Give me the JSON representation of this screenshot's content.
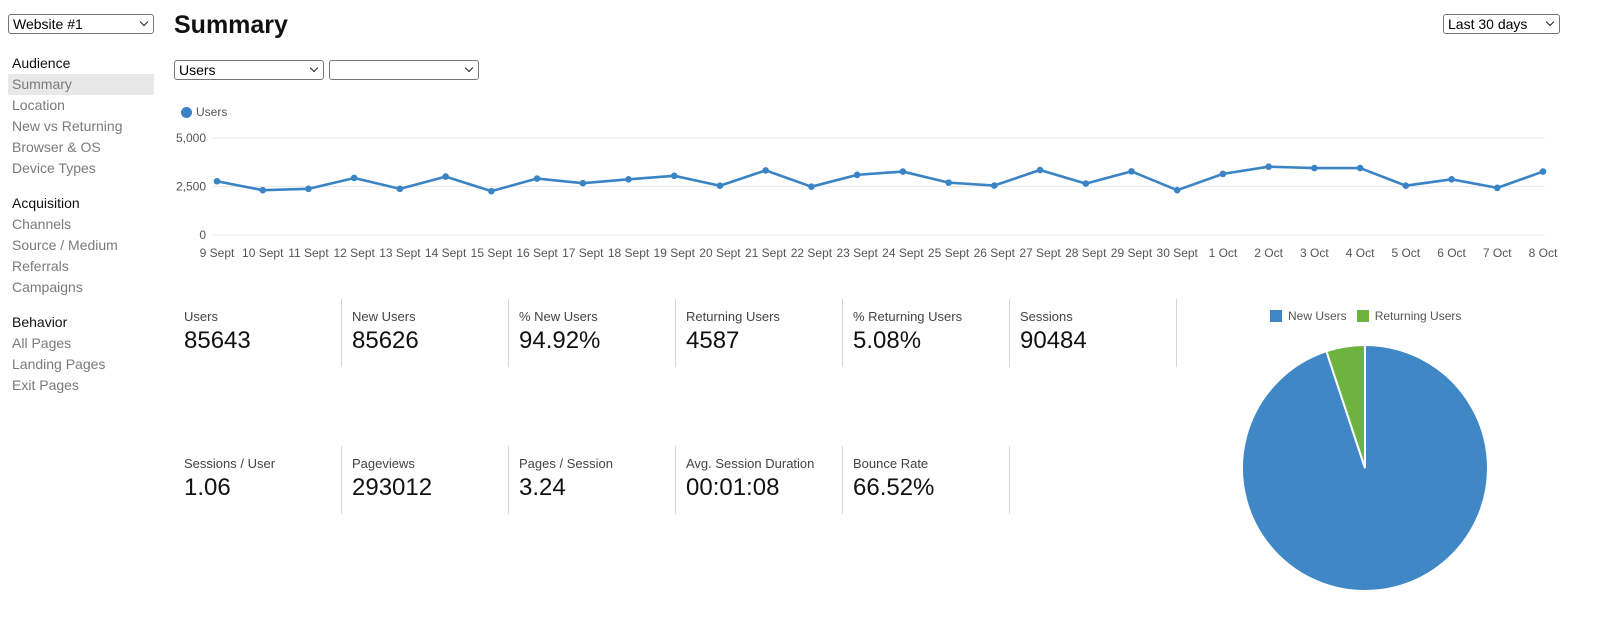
{
  "site_select": {
    "value": "Website #1"
  },
  "range_select": {
    "value": "Last 30 days"
  },
  "page_title": "Summary",
  "metric_select": {
    "value": "Users"
  },
  "compare_select": {
    "value": ""
  },
  "sidebar": {
    "groups": [
      {
        "title": "Audience",
        "items": [
          {
            "label": "Summary",
            "active": true
          },
          {
            "label": "Location"
          },
          {
            "label": "New vs Returning"
          },
          {
            "label": "Browser & OS"
          },
          {
            "label": "Device Types"
          }
        ]
      },
      {
        "title": "Acquisition",
        "items": [
          {
            "label": "Channels"
          },
          {
            "label": "Source / Medium"
          },
          {
            "label": "Referrals"
          },
          {
            "label": "Campaigns"
          }
        ]
      },
      {
        "title": "Behavior",
        "items": [
          {
            "label": "All Pages"
          },
          {
            "label": "Landing Pages"
          },
          {
            "label": "Exit Pages"
          }
        ]
      }
    ]
  },
  "stats": [
    {
      "label": "Users",
      "value": "85643"
    },
    {
      "label": "New Users",
      "value": "85626"
    },
    {
      "label": "% New Users",
      "value": "94.92%"
    },
    {
      "label": "Returning Users",
      "value": "4587"
    },
    {
      "label": "% Returning Users",
      "value": "5.08%"
    },
    {
      "label": "Sessions",
      "value": "90484"
    },
    {
      "label": "Sessions / User",
      "value": "1.06"
    },
    {
      "label": "Pageviews",
      "value": "293012"
    },
    {
      "label": "Pages / Session",
      "value": "3.24"
    },
    {
      "label": "Avg. Session Duration",
      "value": "00:01:08"
    },
    {
      "label": "Bounce Rate",
      "value": "66.52%"
    }
  ],
  "colors": {
    "primary": "#3a83c5",
    "secondary": "#6db33f",
    "grid": "#ebebeb"
  },
  "chart_data": [
    {
      "type": "line",
      "title": "",
      "xlabel": "",
      "ylabel": "",
      "legend": "top-left",
      "grid": true,
      "ylim": [
        0,
        5000
      ],
      "yticks": [
        0,
        2500,
        5000
      ],
      "ytick_labels": [
        "0",
        "2,500",
        "5,000"
      ],
      "categories": [
        "9 Sept",
        "10 Sept",
        "11 Sept",
        "12 Sept",
        "13 Sept",
        "14 Sept",
        "15 Sept",
        "16 Sept",
        "17 Sept",
        "18 Sept",
        "19 Sept",
        "20 Sept",
        "21 Sept",
        "22 Sept",
        "23 Sept",
        "24 Sept",
        "25 Sept",
        "26 Sept",
        "27 Sept",
        "28 Sept",
        "29 Sept",
        "30 Sept",
        "1 Oct",
        "2 Oct",
        "3 Oct",
        "4 Oct",
        "5 Oct",
        "6 Oct",
        "7 Oct",
        "8 Oct"
      ],
      "series": [
        {
          "name": "Users",
          "color": "#3a83c5",
          "values": [
            2770,
            2310,
            2380,
            2940,
            2380,
            3010,
            2260,
            2910,
            2670,
            2870,
            3050,
            2540,
            3330,
            2490,
            3100,
            3270,
            2700,
            2550,
            3350,
            2650,
            3280,
            2310,
            3150,
            3520,
            3450,
            3450,
            2540,
            2870,
            2430,
            3270
          ]
        }
      ]
    },
    {
      "type": "pie",
      "title": "",
      "legend": "top",
      "slices": [
        {
          "name": "New Users",
          "value": 85626,
          "color": "#3f88c5"
        },
        {
          "name": "Returning Users",
          "value": 4587,
          "color": "#6db33f"
        }
      ]
    }
  ]
}
